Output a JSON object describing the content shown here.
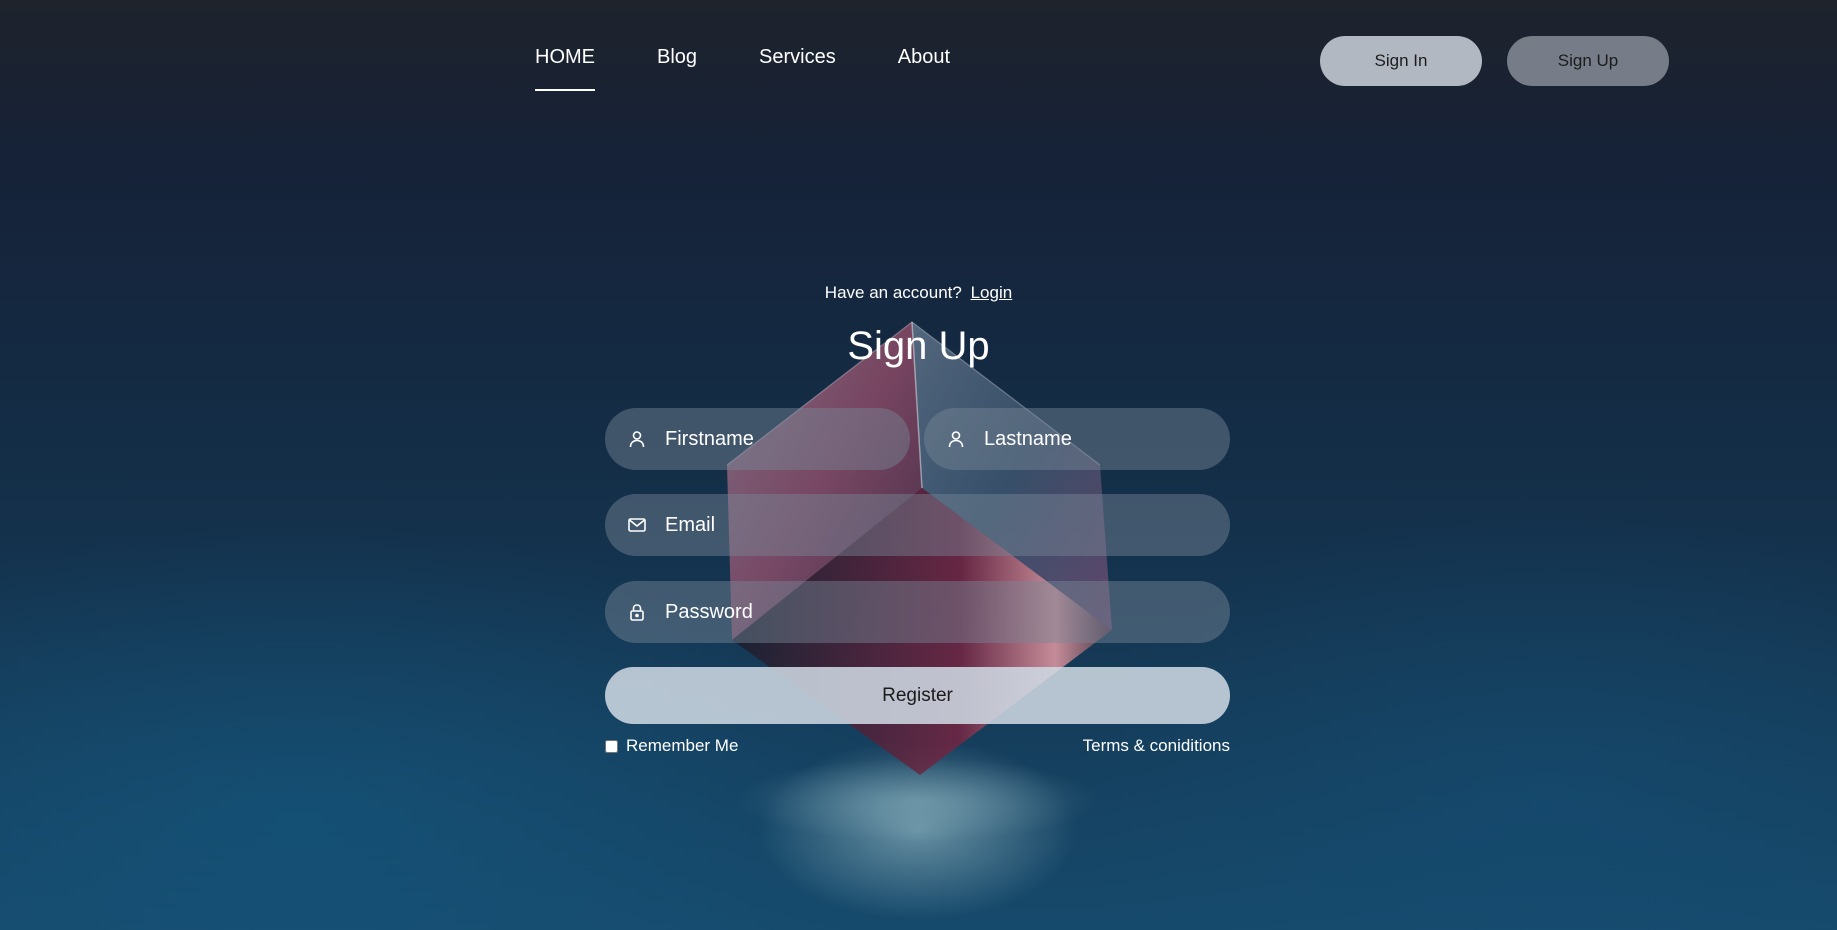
{
  "nav": {
    "items": [
      {
        "label": "HOME",
        "active": true
      },
      {
        "label": "Blog",
        "active": false
      },
      {
        "label": "Services",
        "active": false
      },
      {
        "label": "About",
        "active": false
      }
    ]
  },
  "auth": {
    "signin_label": "Sign In",
    "signup_label": "Sign Up"
  },
  "form": {
    "have_account_text": "Have an account?",
    "login_link": "Login",
    "title": "Sign Up",
    "firstname_placeholder": "Firstname",
    "lastname_placeholder": "Lastname",
    "email_placeholder": "Email",
    "password_placeholder": "Password",
    "register_label": "Register",
    "remember_label": "Remember Me",
    "remember_checked": false,
    "terms_link": "Terms & coniditions"
  },
  "icons": {
    "firstname": "user-icon",
    "lastname": "user-icon",
    "email": "mail-icon",
    "password": "lock-icon"
  },
  "colors": {
    "field_bg": "#78879673",
    "button_light": "#cdd7e1",
    "text": "#ffffff"
  }
}
